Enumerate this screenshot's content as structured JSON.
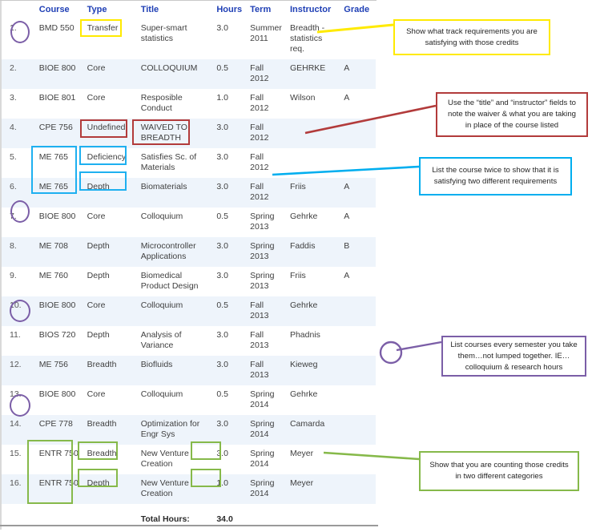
{
  "table": {
    "columns": [
      "",
      "Course",
      "Type",
      "Title",
      "Hours",
      "Term",
      "Instructor",
      "Grade"
    ],
    "rows": [
      {
        "num": "1.",
        "course": "BMD 550",
        "type": "Transfer",
        "title": "Super-smart statistics",
        "hours": "3.0",
        "term": "Summer 2011",
        "instructor": "Breadth - statistics req.",
        "grade": ""
      },
      {
        "num": "2.",
        "course": "BIOE 800",
        "type": "Core",
        "title": "COLLOQUIUM",
        "hours": "0.5",
        "term": "Fall 2012",
        "instructor": "GEHRKE",
        "grade": "A"
      },
      {
        "num": "3.",
        "course": "BIOE 801",
        "type": "Core",
        "title": "Resposible Conduct",
        "hours": "1.0",
        "term": "Fall 2012",
        "instructor": "Wilson",
        "grade": "A"
      },
      {
        "num": "4.",
        "course": "CPE 756",
        "type": "Undefined",
        "title": "WAIVED TO BREADTH",
        "hours": "3.0",
        "term": "Fall 2012",
        "instructor": "",
        "grade": ""
      },
      {
        "num": "5.",
        "course": "ME 765",
        "type": "Deficiency",
        "title": "Satisfies Sc. of Materials",
        "hours": "3.0",
        "term": "Fall 2012",
        "instructor": "",
        "grade": ""
      },
      {
        "num": "6.",
        "course": "ME 765",
        "type": "Depth",
        "title": "Biomaterials",
        "hours": "3.0",
        "term": "Fall 2012",
        "instructor": "Friis",
        "grade": "A"
      },
      {
        "num": "7.",
        "course": "BIOE 800",
        "type": "Core",
        "title": "Colloquium",
        "hours": "0.5",
        "term": "Spring 2013",
        "instructor": "Gehrke",
        "grade": "A"
      },
      {
        "num": "8.",
        "course": "ME 708",
        "type": "Depth",
        "title": "Microcontroller Applications",
        "hours": "3.0",
        "term": "Spring 2013",
        "instructor": "Faddis",
        "grade": "B"
      },
      {
        "num": "9.",
        "course": "ME 760",
        "type": "Depth",
        "title": "Biomedical Product Design",
        "hours": "3.0",
        "term": "Spring 2013",
        "instructor": "Friis",
        "grade": "A"
      },
      {
        "num": "10.",
        "course": "BIOE 800",
        "type": "Core",
        "title": "Colloquium",
        "hours": "0.5",
        "term": "Fall 2013",
        "instructor": "Gehrke",
        "grade": ""
      },
      {
        "num": "11.",
        "course": "BIOS 720",
        "type": "Depth",
        "title": "Analysis of Variance",
        "hours": "3.0",
        "term": "Fall 2013",
        "instructor": "Phadnis",
        "grade": ""
      },
      {
        "num": "12.",
        "course": "ME 756",
        "type": "Breadth",
        "title": "Biofluids",
        "hours": "3.0",
        "term": "Fall 2013",
        "instructor": "Kieweg",
        "grade": ""
      },
      {
        "num": "13.",
        "course": "BIOE 800",
        "type": "Core",
        "title": "Colloquium",
        "hours": "0.5",
        "term": "Spring 2014",
        "instructor": "Gehrke",
        "grade": ""
      },
      {
        "num": "14.",
        "course": "CPE 778",
        "type": "Breadth",
        "title": "Optimization for Engr Sys",
        "hours": "3.0",
        "term": "Spring 2014",
        "instructor": "Camarda",
        "grade": ""
      },
      {
        "num": "15.",
        "course": "ENTR 750",
        "type": "Breadth",
        "title": "New Venture Creation",
        "hours": "3.0",
        "term": "Spring 2014",
        "instructor": "Meyer",
        "grade": ""
      },
      {
        "num": "16.",
        "course": "ENTR 750",
        "type": "Depth",
        "title": "New Venture Creation",
        "hours": "1.0",
        "term": "Spring 2014",
        "instructor": "Meyer",
        "grade": ""
      }
    ],
    "total_label": "Total Hours:",
    "total_value": "34.0"
  },
  "annotations": {
    "yellow": {
      "text": "Show what track requirements you are satisfying with those credits",
      "color": "#ffea00"
    },
    "red": {
      "text": "Use the “title” and “instructor” fields to note the waiver & what you are taking in place of the course listed",
      "color": "#b23b3b"
    },
    "blue": {
      "text": "List the course twice to show that it is satisfying two different requirements",
      "color": "#00aeef"
    },
    "purple": {
      "text": "List courses every semester you take them…not lumped together. IE…colloquium & research hours",
      "color": "#7b5ea7"
    },
    "green": {
      "text": "Show that you are counting those credits in two different categories",
      "color": "#86b94a"
    }
  },
  "colors": {
    "header_text": "#1f3fb5",
    "row_stripe": "#eef4fb",
    "body_text": "#3f3f3f"
  }
}
